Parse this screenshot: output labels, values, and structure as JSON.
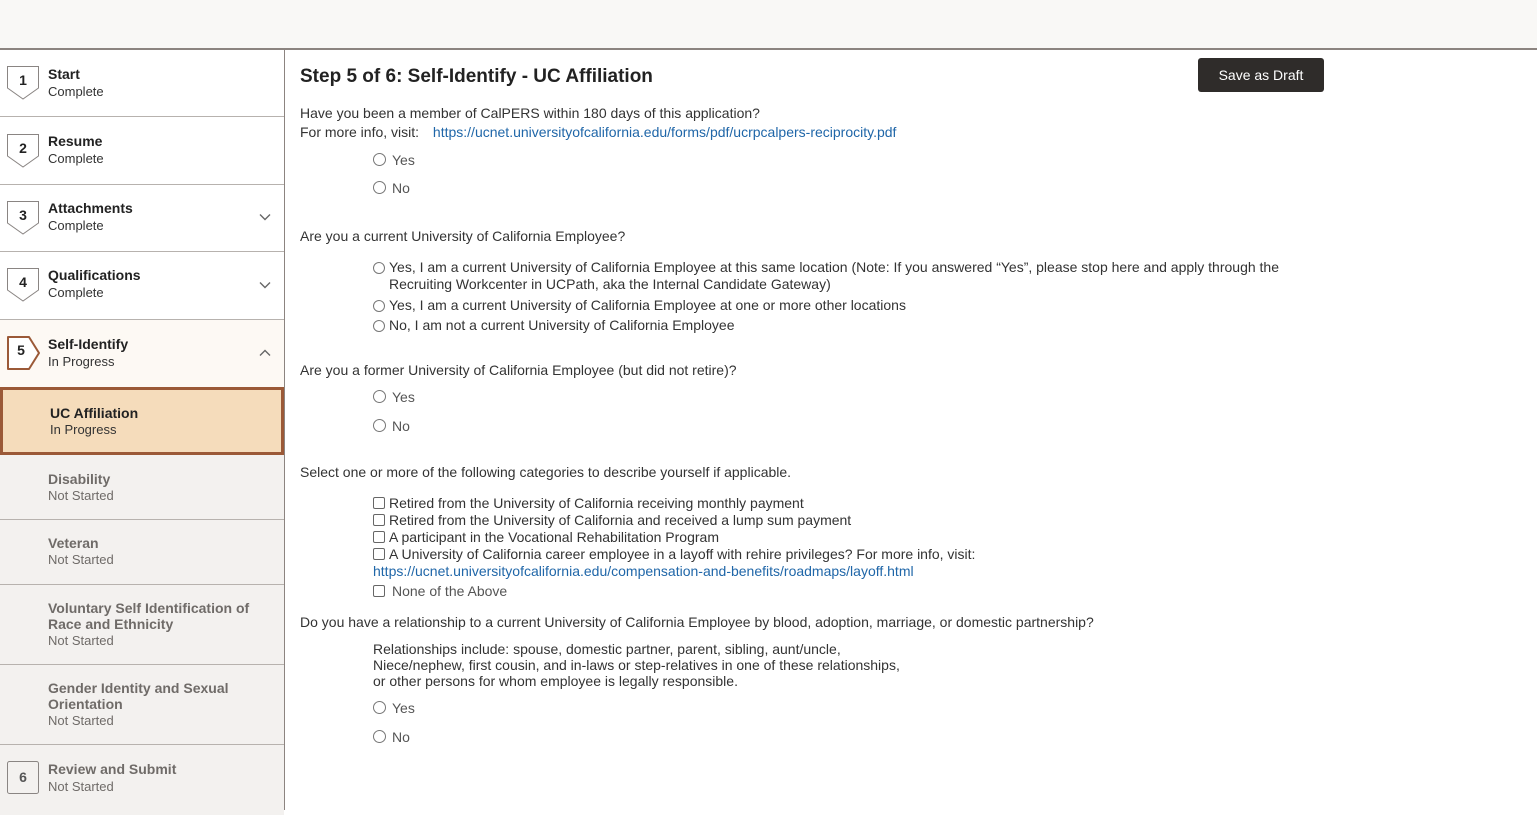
{
  "sidebar": {
    "steps": [
      {
        "number": "1",
        "title": "Start",
        "status": "Complete"
      },
      {
        "number": "2",
        "title": "Resume",
        "status": "Complete"
      },
      {
        "number": "3",
        "title": "Attachments",
        "status": "Complete"
      },
      {
        "number": "4",
        "title": "Qualifications",
        "status": "Complete"
      },
      {
        "number": "5",
        "title": "Self-Identify",
        "status": "In Progress"
      },
      {
        "number": "6",
        "title": "Review and Submit",
        "status": "Not Started"
      }
    ],
    "substeps": [
      {
        "title": "UC Affiliation",
        "status": "In Progress"
      },
      {
        "title": "Disability",
        "status": "Not Started"
      },
      {
        "title": "Veteran",
        "status": "Not Started"
      },
      {
        "title": "Voluntary Self Identification of Race and Ethnicity",
        "status": "Not Started"
      },
      {
        "title": "Gender Identity and Sexual Orientation",
        "status": "Not Started"
      }
    ],
    "colors": {
      "active_fill": "#f5dcbb",
      "active_border": "#9b5937"
    }
  },
  "main": {
    "title": "Step 5 of 6: Self-Identify - UC Affiliation",
    "save_draft_label": "Save as Draft",
    "q1": {
      "text": "Have you been a member of CalPERS within 180 days of this application?",
      "info_prefix": "For more info, visit:",
      "link": "https://ucnet.universityofcalifornia.edu/forms/pdf/ucrpcalpers-reciprocity.pdf",
      "options": [
        "Yes",
        "No"
      ]
    },
    "q2": {
      "text": "Are you a current University of California Employee?",
      "options": [
        "Yes, I am a current University of California Employee at this same location (Note: If you answered “Yes”, please stop here and apply through the Recruiting Workcenter in UCPath, aka the Internal Candidate Gateway)",
        "Yes, I am a current University of California Employee at one or more other locations",
        "No, I am not a current University of California Employee"
      ]
    },
    "q3": {
      "text": "Are you a former University of California Employee (but did not retire)?",
      "options": [
        "Yes",
        "No"
      ]
    },
    "q4": {
      "text": "Select one or more of the following categories to describe yourself if applicable.",
      "options": [
        "Retired from the University of California receiving monthly payment",
        "Retired from the University of California and received a lump sum payment",
        "A participant in the Vocational Rehabilitation Program",
        "A University of California career employee in a layoff with rehire privileges? For more info, visit:"
      ],
      "layoff_link": "https://ucnet.universityofcalifornia.edu/compensation-and-benefits/roadmaps/layoff.html",
      "none_option": "None of the Above"
    },
    "q5": {
      "text": "Do you have a relationship to a current University of California Employee by blood, adoption, marriage, or domestic partnership?",
      "note_lines": [
        "Relationships include: spouse, domestic partner, parent, sibling, aunt/uncle,",
        "Niece/nephew, first cousin, and in-laws or step-relatives in one of these relationships,",
        "or other persons for whom employee is legally responsible."
      ],
      "options": [
        "Yes",
        "No"
      ]
    }
  }
}
